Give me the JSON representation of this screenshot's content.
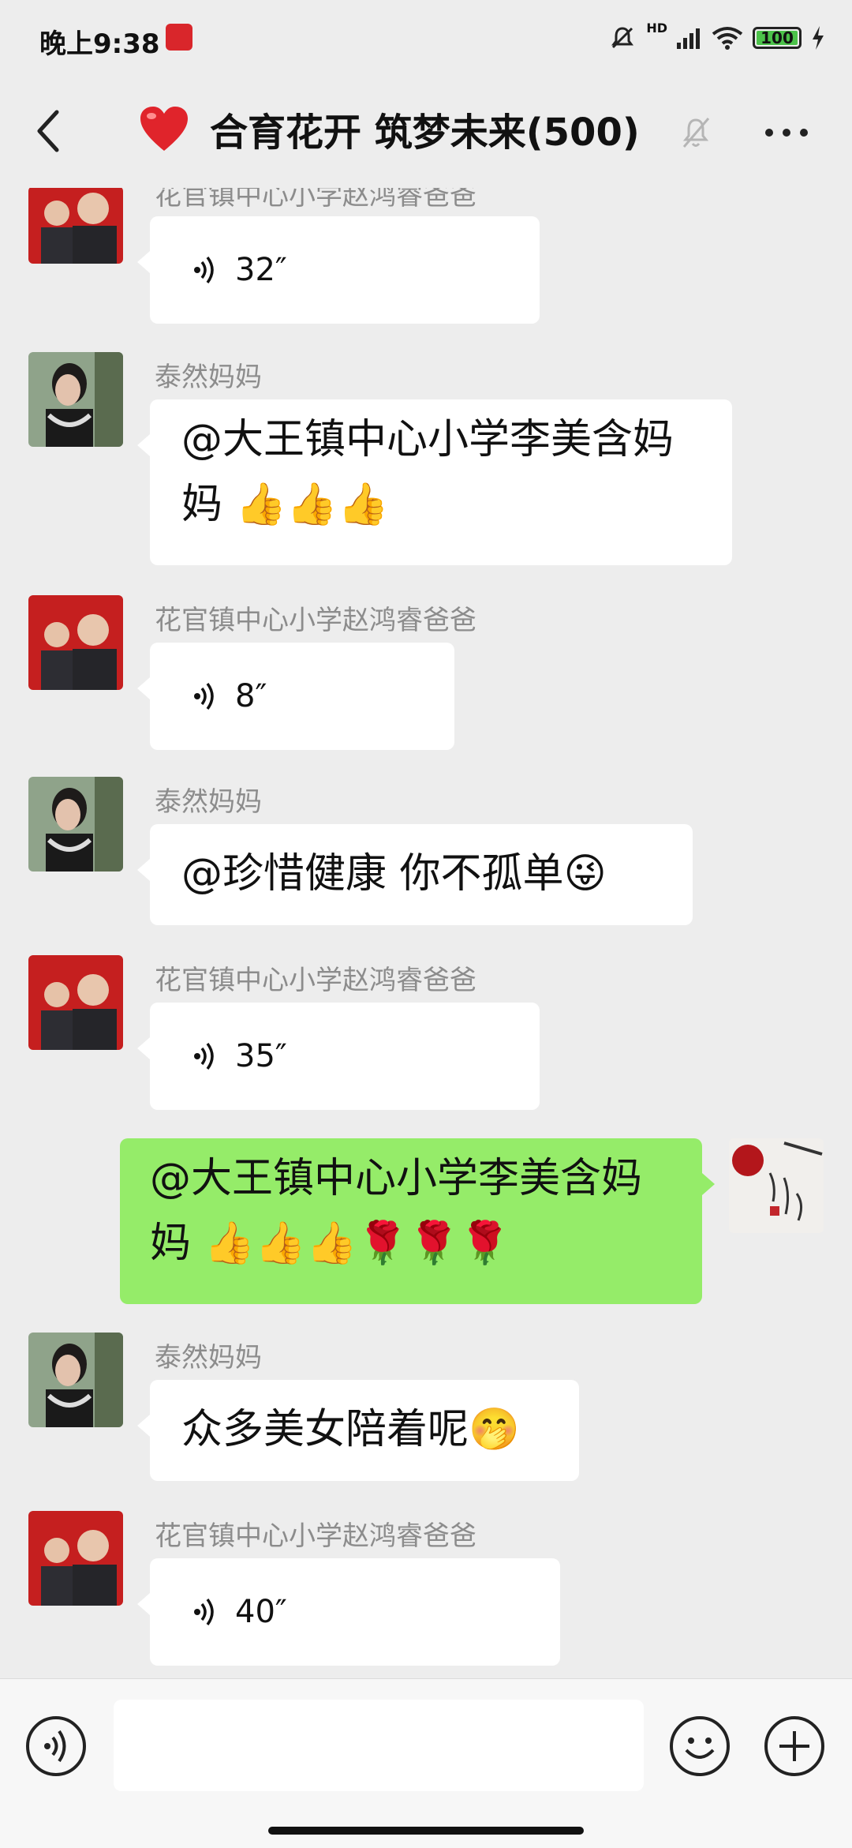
{
  "status": {
    "time": "晚上9:38",
    "battery": "100",
    "network": "HD"
  },
  "header": {
    "title": "合育花开 筑梦未来(500)",
    "title_emoji": "❤️"
  },
  "messages": [
    {
      "sender": "花官镇中心小学赵鸿睿爸爸",
      "type": "voice",
      "duration": "32″"
    },
    {
      "sender": "泰然妈妈",
      "type": "text",
      "text": "@大王镇中心小学李美含妈妈 👍👍👍"
    },
    {
      "sender": "花官镇中心小学赵鸿睿爸爸",
      "type": "voice",
      "duration": "8″"
    },
    {
      "sender": "泰然妈妈",
      "type": "text",
      "text": "@珍惜健康  你不孤单😜"
    },
    {
      "sender": "花官镇中心小学赵鸿睿爸爸",
      "type": "voice",
      "duration": "35″"
    },
    {
      "sender": "me",
      "type": "text",
      "text": "@大王镇中心小学李美含妈妈 👍👍👍🌹🌹🌹"
    },
    {
      "sender": "泰然妈妈",
      "type": "text",
      "text": "众多美女陪着呢🤭"
    },
    {
      "sender": "花官镇中心小学赵鸿睿爸爸",
      "type": "voice",
      "duration": "40″"
    }
  ],
  "input": {
    "placeholder": ""
  },
  "icons": {
    "back": "chevron-left-icon",
    "mute": "bell-off-icon",
    "more": "more-dots-icon",
    "voice": "voice-wave-icon",
    "emoji": "smiley-icon",
    "plus": "plus-icon"
  },
  "colors": {
    "background": "#ededed",
    "bubble_in": "#ffffff",
    "bubble_out": "#95ec69",
    "sender": "#8c8c8c"
  }
}
